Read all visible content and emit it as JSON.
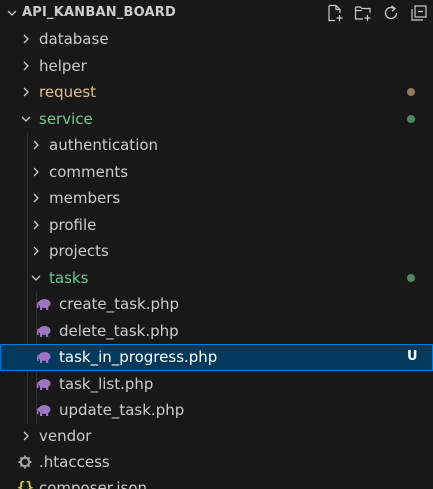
{
  "explorer": {
    "root_title": "API_KANBAN_BOARD",
    "actions": [
      {
        "name": "new-file-icon",
        "label": "New File"
      },
      {
        "name": "new-folder-icon",
        "label": "New Folder"
      },
      {
        "name": "refresh-icon",
        "label": "Refresh Explorer"
      },
      {
        "name": "collapse-all-icon",
        "label": "Collapse Folders"
      }
    ],
    "items": [
      {
        "label": "database",
        "kind": "folder",
        "expanded": false
      },
      {
        "label": "helper",
        "kind": "folder",
        "expanded": false
      },
      {
        "label": "request",
        "kind": "folder",
        "expanded": false,
        "status": "modified"
      },
      {
        "label": "service",
        "kind": "folder",
        "expanded": true,
        "status": "untracked"
      },
      {
        "label": "authentication",
        "kind": "folder",
        "expanded": false
      },
      {
        "label": "comments",
        "kind": "folder",
        "expanded": false
      },
      {
        "label": "members",
        "kind": "folder",
        "expanded": false
      },
      {
        "label": "profile",
        "kind": "folder",
        "expanded": false
      },
      {
        "label": "projects",
        "kind": "folder",
        "expanded": false
      },
      {
        "label": "tasks",
        "kind": "folder",
        "expanded": true,
        "status": "untracked"
      },
      {
        "label": "create_task.php",
        "kind": "php-file"
      },
      {
        "label": "delete_task.php",
        "kind": "php-file"
      },
      {
        "label": "task_in_progress.php",
        "kind": "php-file",
        "selected": true,
        "git_badge": "U"
      },
      {
        "label": "task_list.php",
        "kind": "php-file"
      },
      {
        "label": "update_task.php",
        "kind": "php-file"
      },
      {
        "label": "vendor",
        "kind": "folder",
        "expanded": false
      },
      {
        "label": ".htaccess",
        "kind": "config-file"
      },
      {
        "label": "composer.json",
        "kind": "json-file"
      }
    ]
  },
  "colors": {
    "background": "#181818",
    "text_default": "#cccccc",
    "text_modified": "#e2c08d",
    "text_untracked": "#73c991",
    "dot_modified": "#8f7a5c",
    "dot_untracked": "#4e8a5f",
    "selection_bg": "#04395e",
    "selection_border": "#0078d4",
    "php_icon": "#a074c4",
    "json_icon": "#cbcb41"
  }
}
